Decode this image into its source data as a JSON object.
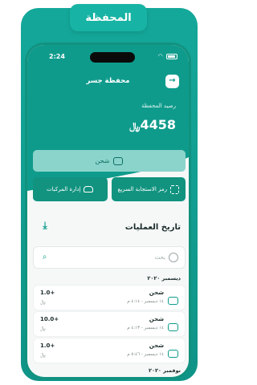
{
  "banner": {
    "title": "المحفظة"
  },
  "status_bar": {
    "time": "2:24"
  },
  "header": {
    "title": "محفظة جسر",
    "back_icon": "arrow-right-icon"
  },
  "balance": {
    "label": "رصيد المحفظة",
    "amount": "4458",
    "currency": "﷼"
  },
  "actions": {
    "topup_label": "شحن",
    "qr_label": "رمز الاستجابة السريع",
    "vehicles_label": "إدارة المركبات"
  },
  "history": {
    "title": "تاريخ العمليات",
    "search_placeholder": "بحث"
  },
  "months": {
    "first": "ديسمبر ٢٠٢٠",
    "second": "نوفمبر ٢٠٢٠"
  },
  "transactions": [
    {
      "title": "شحن",
      "date": "١٤ ديسمبر - ٤:١٤ م",
      "amount": "1.0+",
      "currency": "﷼"
    },
    {
      "title": "شحن",
      "date": "١٤ ديسمبر - ٤:١٣ م",
      "amount": "10.0+",
      "currency": "﷼"
    },
    {
      "title": "شحن",
      "date": "١٤ ديسمبر - ٥:٤٦ م",
      "amount": "1.0+",
      "currency": "﷼"
    }
  ],
  "colors": {
    "primary": "#0f9b8c",
    "light": "#8bd4cb",
    "background": "#f6f8f8"
  }
}
